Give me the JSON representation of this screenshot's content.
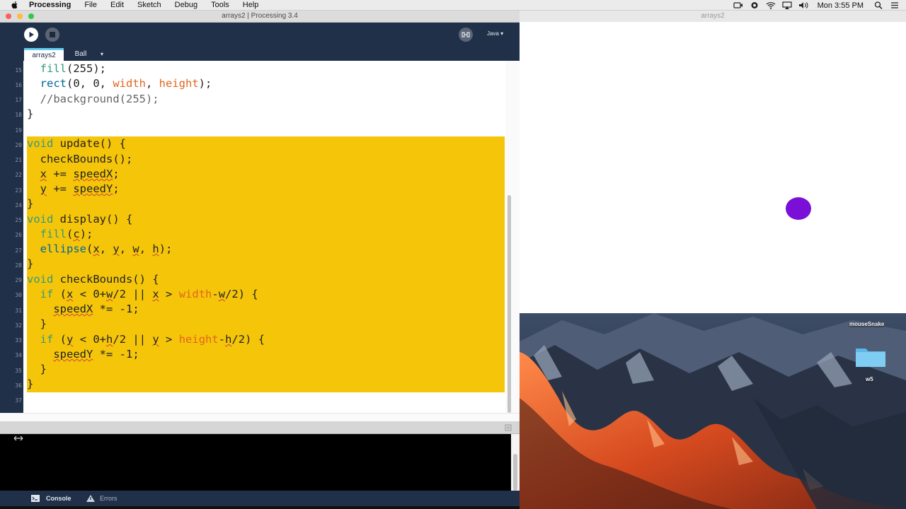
{
  "menubar": {
    "app_name": "Processing",
    "items": [
      "File",
      "Edit",
      "Sketch",
      "Debug",
      "Tools",
      "Help"
    ],
    "clock": "Mon 3:55 PM"
  },
  "window": {
    "title": "arrays2 | Processing 3.4"
  },
  "toolbar": {
    "mode_label": "Java ▾"
  },
  "tabs": {
    "active": "arrays2",
    "second": "Ball",
    "more": "▾"
  },
  "editor": {
    "line_numbers": [
      "15",
      "16",
      "17",
      "18",
      "19",
      "20",
      "21",
      "22",
      "23",
      "24",
      "25",
      "26",
      "27",
      "28",
      "29",
      "30",
      "31",
      "32",
      "33",
      "34",
      "35",
      "36",
      "37"
    ]
  },
  "footer": {
    "console_label": "Console",
    "errors_label": "Errors"
  },
  "sketch_window": {
    "title": "arrays2",
    "ball_color": "#7a10d8"
  },
  "desktop": {
    "item1_label": "mouseSnake",
    "folder_label": "w5"
  },
  "colors": {
    "highlight": "#f5c50a",
    "ide_dark": "#203049",
    "tab_accent": "#64cdf1"
  }
}
